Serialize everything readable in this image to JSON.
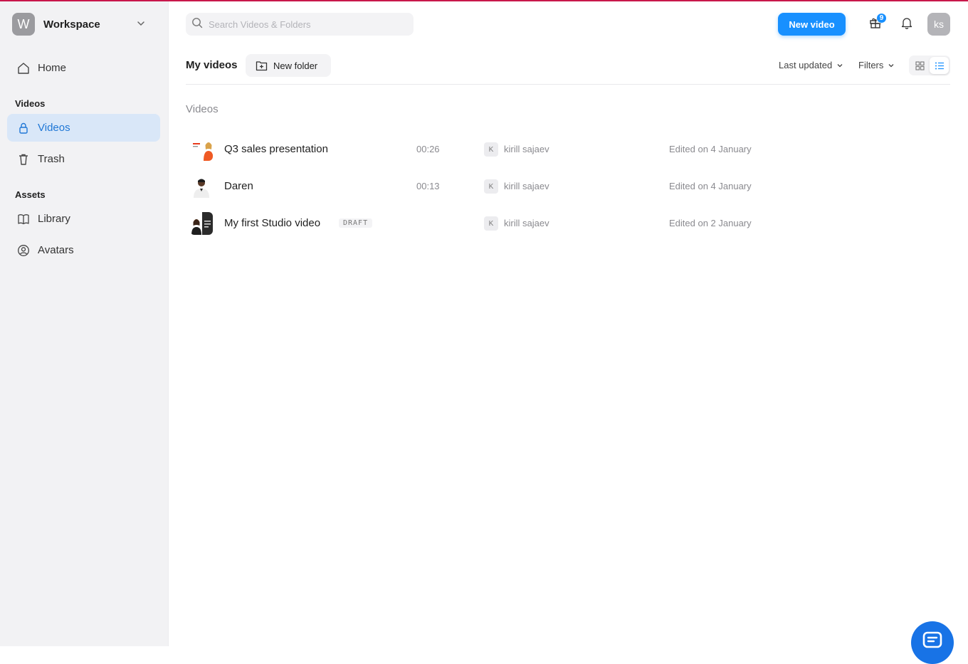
{
  "sidebar": {
    "workspace": {
      "logo_letter": "W",
      "name": "Workspace"
    },
    "home_label": "Home",
    "videos_section": "Videos",
    "videos_label": "Videos",
    "trash_label": "Trash",
    "assets_section": "Assets",
    "library_label": "Library",
    "avatars_label": "Avatars"
  },
  "header": {
    "search_placeholder": "Search Videos & Folders",
    "new_video_label": "New video",
    "gift_badge": "9",
    "user_initials": "ks"
  },
  "toolbar": {
    "title": "My videos",
    "new_folder_label": "New folder",
    "sort_label": "Last updated",
    "filters_label": "Filters",
    "active_view": "list"
  },
  "content": {
    "section_title": "Videos",
    "videos": [
      {
        "title": "Q3 sales presentation",
        "duration": "00:26",
        "owner_initial": "K",
        "owner": "kirill sajaev",
        "edited": "Edited on 4 January",
        "draft": ""
      },
      {
        "title": "Daren",
        "duration": "00:13",
        "owner_initial": "K",
        "owner": "kirill sajaev",
        "edited": "Edited on 4 January",
        "draft": ""
      },
      {
        "title": "My first Studio video",
        "duration": "",
        "owner_initial": "K",
        "owner": "kirill sajaev",
        "edited": "Edited on 2 January",
        "draft": "DRAFT"
      }
    ]
  },
  "colors": {
    "accent": "#1890ff",
    "active_nav_bg": "#d9e7f8",
    "active_nav_text": "#1f77d6",
    "top_line": "#c8174b"
  },
  "icons": [
    "chevron-down-icon",
    "home-icon",
    "lock-icon",
    "trash-icon",
    "book-icon",
    "avatar-icon",
    "search-icon",
    "gift-icon",
    "bell-icon",
    "folder-plus-icon",
    "grid-icon",
    "list-icon",
    "chat-icon"
  ]
}
